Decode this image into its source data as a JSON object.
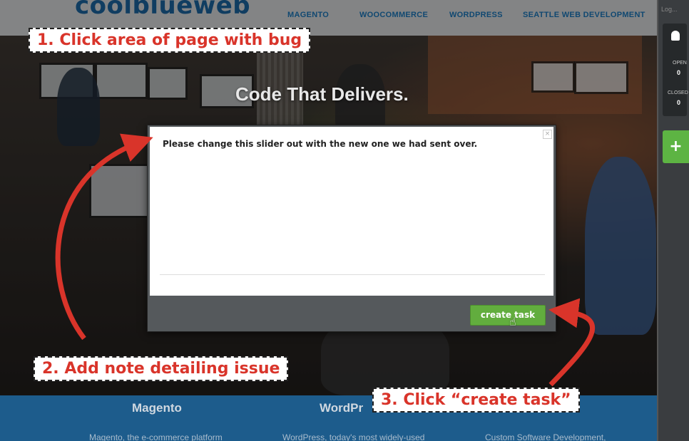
{
  "header": {
    "logo": "coolblueweb",
    "nav": [
      "MAGENTO",
      "WOOCOMMERCE",
      "WORDPRESS",
      "SEATTLE WEB DEVELOPMENT"
    ]
  },
  "hero": {
    "title": "Code That Delivers."
  },
  "modal": {
    "note_text": "Please change this slider out with the new one we had sent over.",
    "close_glyph": "×",
    "create_button": "create task"
  },
  "sidebar": {
    "top_text": "Log...",
    "open_label": "OPEN",
    "open_count": "0",
    "closed_label": "CLOSED",
    "closed_count": "0",
    "add_glyph": "+"
  },
  "footer_band": {
    "headings": [
      "Magento",
      "WordPr"
    ],
    "blurbs": [
      "Magento, the e-commerce platform",
      "WordPress, today's most widely-used",
      "Custom Software Development,"
    ]
  },
  "callouts": {
    "step1": "1. Click area of page with bug",
    "step2": "2. Add note detailing issue",
    "step3": "3. Click “create task”"
  },
  "colors": {
    "accent_red": "#d9342a",
    "brand_blue": "#1a5f96",
    "button_green": "#62ad3e"
  }
}
